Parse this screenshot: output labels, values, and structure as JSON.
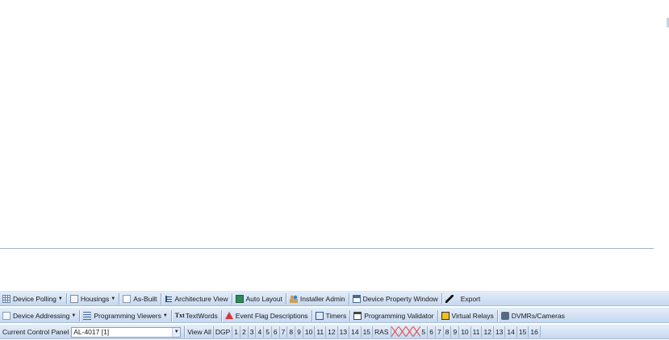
{
  "toolbar1": {
    "device_polling": "Device Polling",
    "housings": "Housings",
    "as_built": "As-Built",
    "architecture_view": "Architecture View",
    "auto_layout": "Auto Layout",
    "installer_admin": "Installer Admin",
    "device_property_window": "Device Property Window",
    "export": "Export"
  },
  "toolbar2": {
    "device_addressing": "Device Addressing",
    "programming_viewers": "Programming Viewers",
    "textwords_badge": "Txt",
    "textwords": "TextWords",
    "event_flag_descriptions": "Event Flag Descriptions",
    "timers": "Timers",
    "programming_validator": "Programming Validator",
    "virtual_relays": "Virtual Relays",
    "dvmrs_cameras": "DVMRs/Cameras"
  },
  "toolbar3": {
    "current_control_panel_label": "Current Control Panel",
    "current_control_panel_value": "AL-4017 [1]",
    "view_all": "View All",
    "dgp": "DGP",
    "dgp_numbers": [
      "1",
      "2",
      "3",
      "4",
      "5",
      "6",
      "7",
      "8",
      "9",
      "10",
      "11",
      "12",
      "13",
      "14",
      "15"
    ],
    "ras": "RAS",
    "ras_numbers": [
      "5",
      "6",
      "7",
      "8",
      "9",
      "10",
      "11",
      "12",
      "13",
      "14",
      "15",
      "16"
    ]
  }
}
